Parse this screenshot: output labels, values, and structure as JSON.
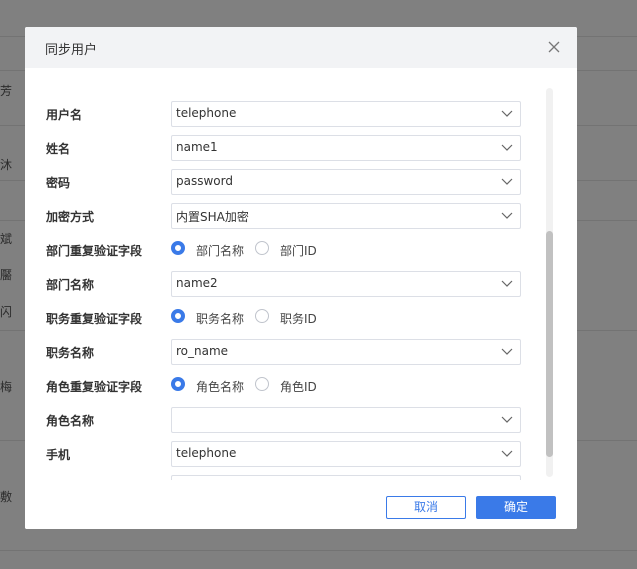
{
  "background": {
    "chars": [
      "芳",
      "沐",
      "斌",
      "靨",
      "闪",
      "梅",
      "敷"
    ]
  },
  "dialog": {
    "title": "同步用户",
    "fields": [
      {
        "label": "用户名",
        "type": "select",
        "value": "telephone"
      },
      {
        "label": "姓名",
        "type": "select",
        "value": "name1"
      },
      {
        "label": "密码",
        "type": "select",
        "value": "password"
      },
      {
        "label": "加密方式",
        "type": "select",
        "value": "内置SHA加密"
      },
      {
        "label": "部门重复验证字段",
        "type": "radio",
        "options": [
          "部门名称",
          "部门ID"
        ],
        "selected": "部门名称"
      },
      {
        "label": "部门名称",
        "type": "select",
        "value": "name2"
      },
      {
        "label": "职务重复验证字段",
        "type": "radio",
        "options": [
          "职务名称",
          "职务ID"
        ],
        "selected": "职务名称"
      },
      {
        "label": "职务名称",
        "type": "select",
        "value": "ro_name"
      },
      {
        "label": "角色重复验证字段",
        "type": "radio",
        "options": [
          "角色名称",
          "角色ID"
        ],
        "selected": "角色名称"
      },
      {
        "label": "角色名称",
        "type": "select",
        "value": ""
      },
      {
        "label": "手机",
        "type": "select",
        "value": "telephone"
      }
    ],
    "buttons": {
      "cancel": "取消",
      "ok": "确定"
    }
  },
  "colors": {
    "primary": "#3a7ae8",
    "overlay": "#808080",
    "header_bg": "#f2f3f5"
  }
}
